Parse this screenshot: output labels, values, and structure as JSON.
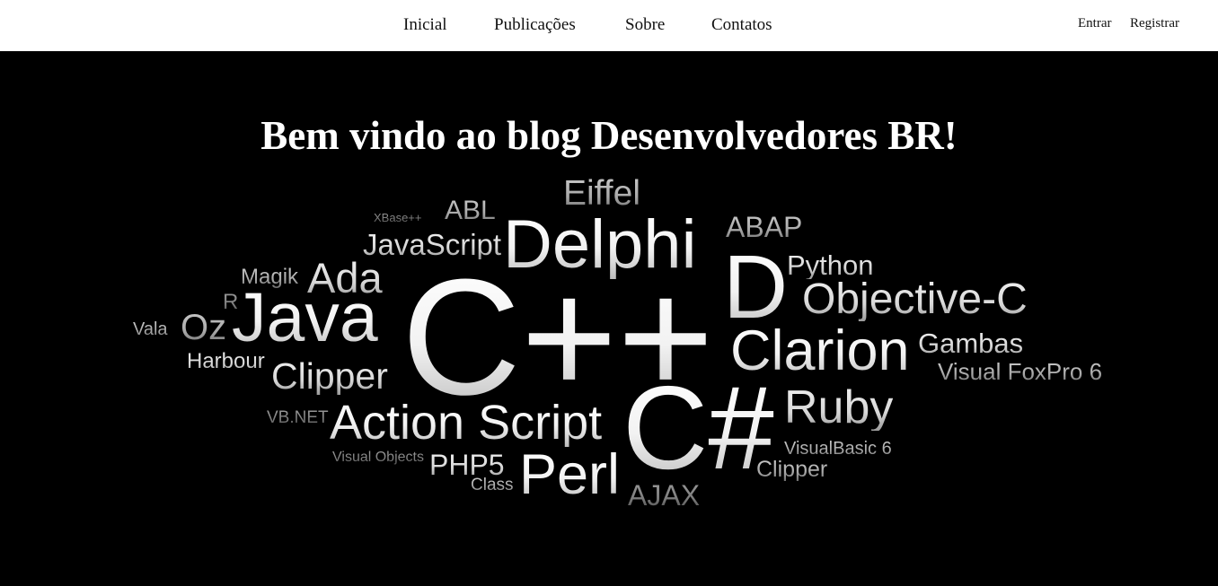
{
  "nav": {
    "items": [
      {
        "label": "Inicial"
      },
      {
        "label": "Publicações"
      },
      {
        "label": "Sobre"
      },
      {
        "label": "Contatos"
      }
    ]
  },
  "auth": {
    "login_label": "Entrar",
    "register_label": "Registrar"
  },
  "hero": {
    "title": "Bem vindo ao blog Desenvolvedores BR!"
  },
  "word_cloud": {
    "words": [
      "Eiffel",
      "XBase++",
      "ABL",
      "Delphi",
      "ABAP",
      "JavaScript",
      "Magik",
      "Ada",
      "D",
      "Python",
      "Objective-C",
      "R",
      "Vala",
      "Oz",
      "Java",
      "C++",
      "Clarion",
      "Gambas",
      "Harbour",
      "Clipper",
      "Visual FoxPro 6",
      "VB.NET",
      "Action Script",
      "C#",
      "Ruby",
      "Visual Objects",
      "PHP5",
      "Perl",
      "VisualBasic 6",
      "Clipper",
      "Class",
      "AJAX"
    ]
  }
}
